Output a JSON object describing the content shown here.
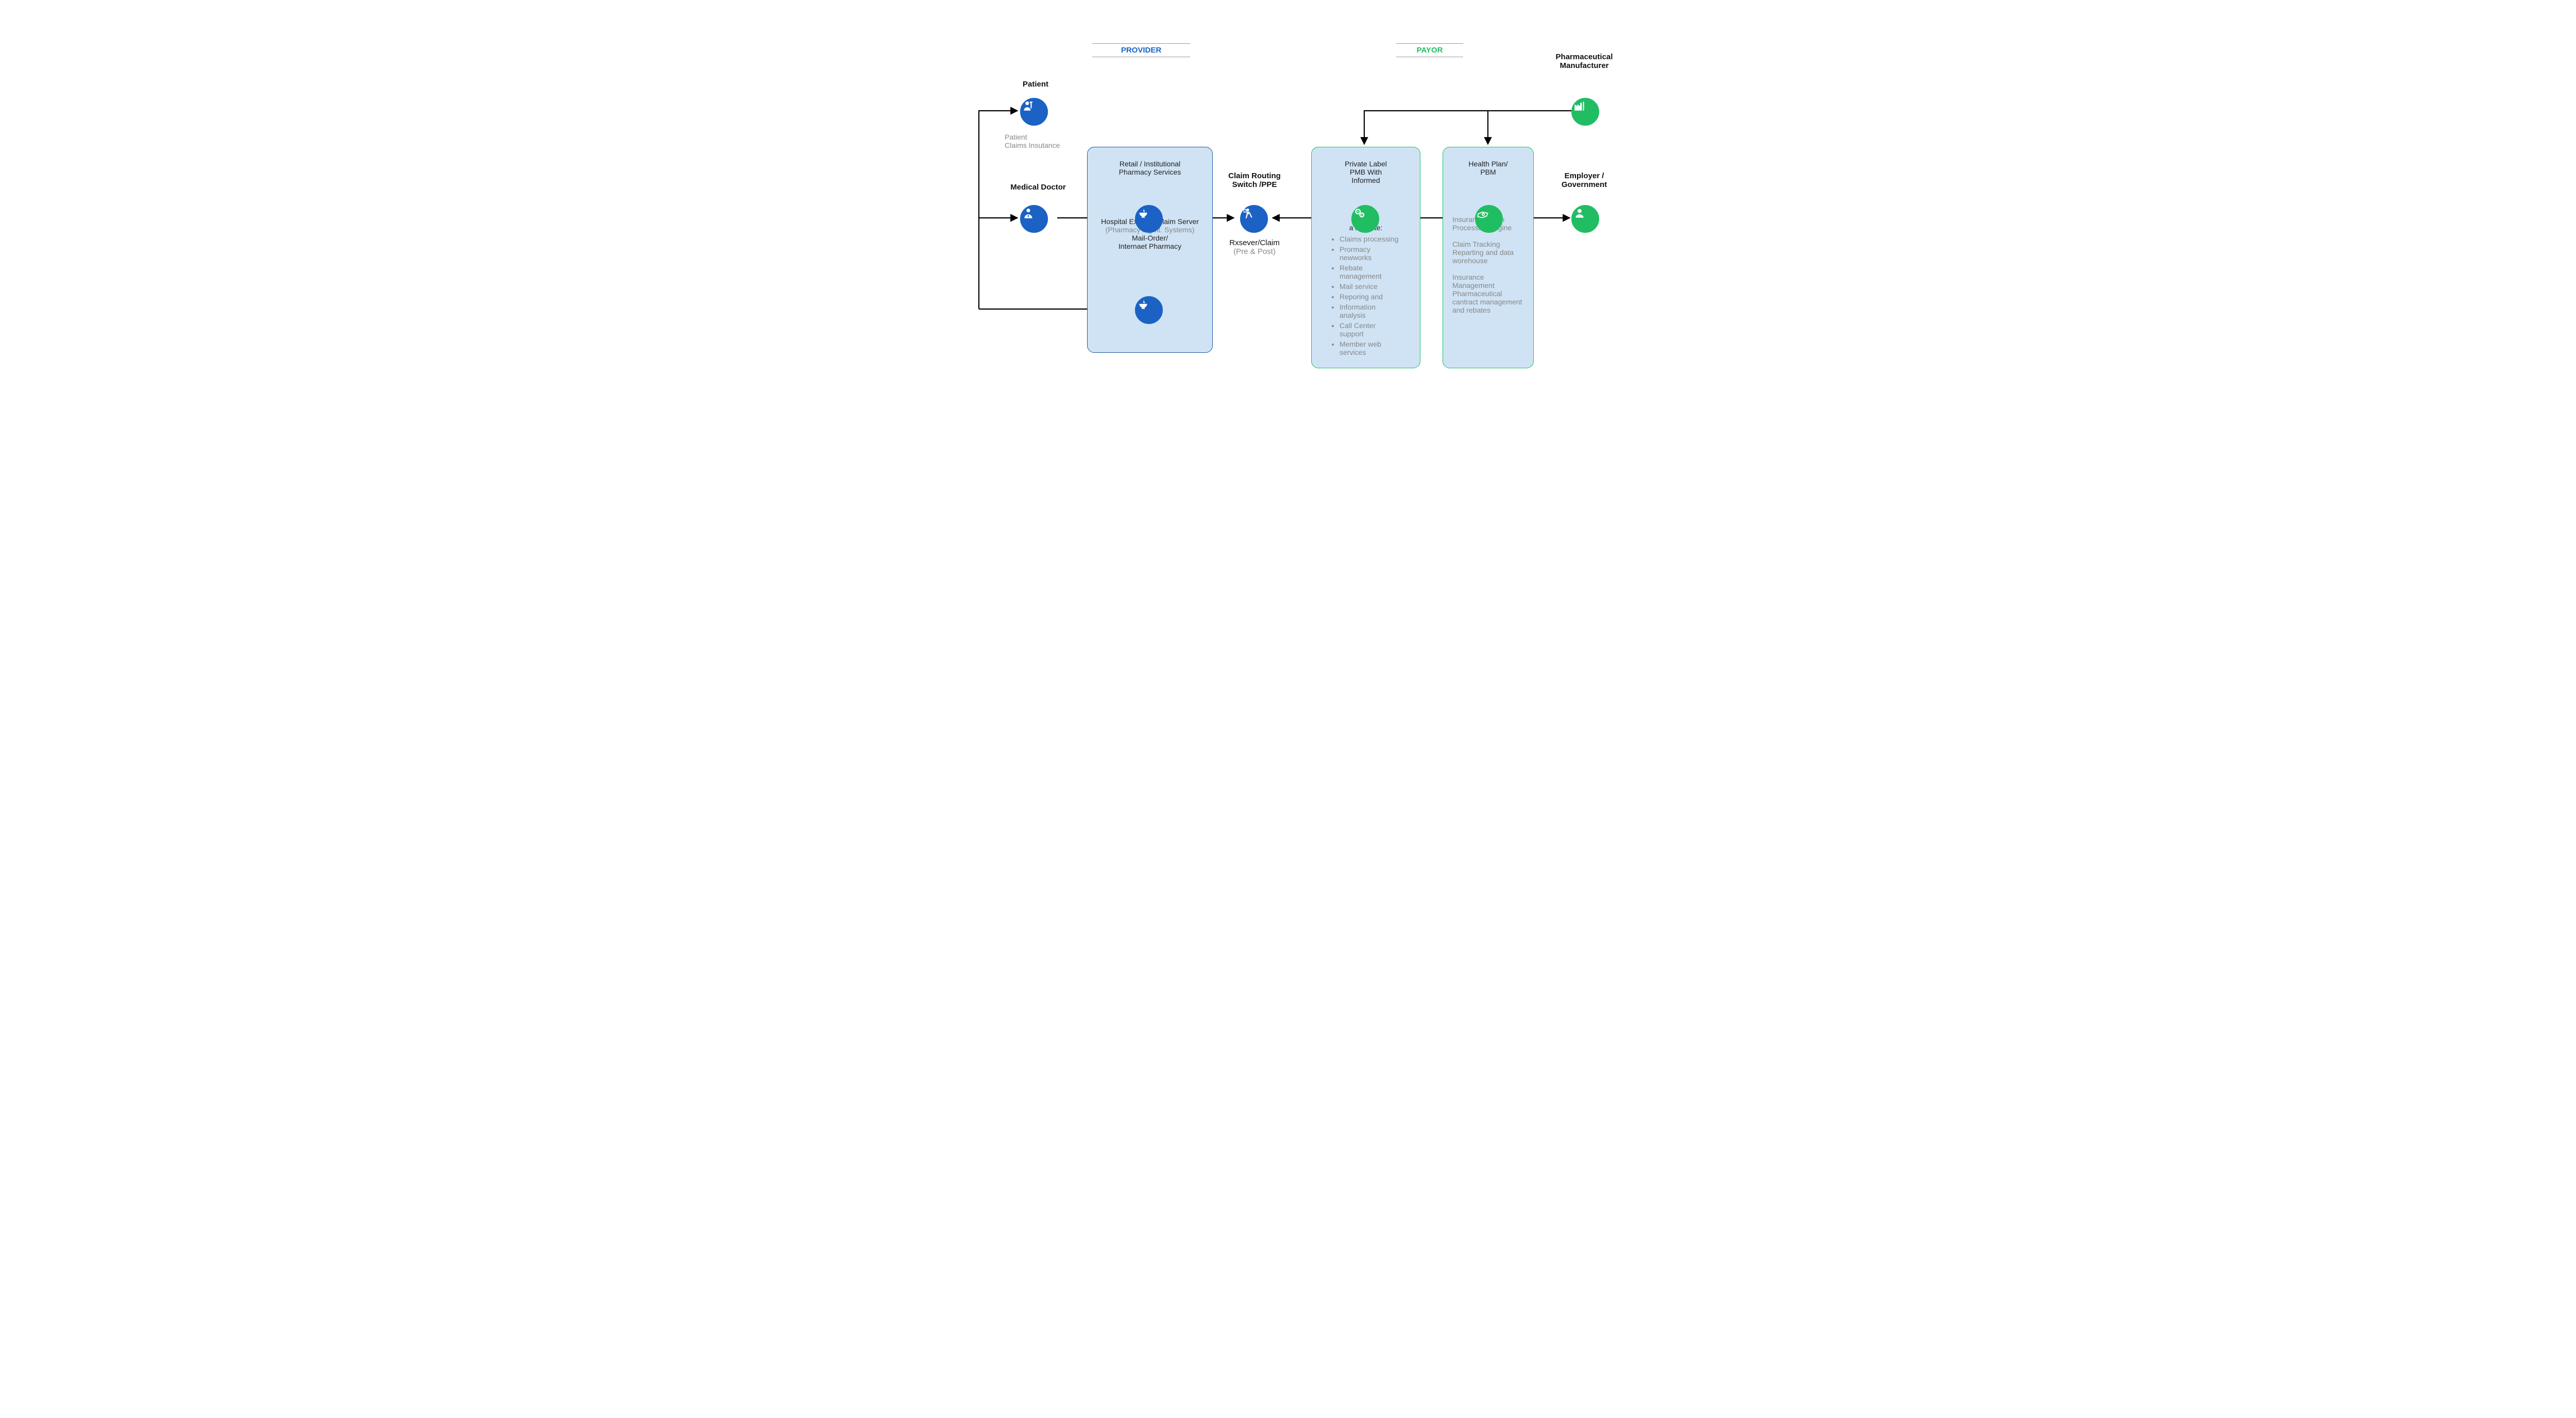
{
  "colors": {
    "blue": "#1b62c4",
    "green": "#21bd62",
    "box": "#cfe3f5",
    "grey": "#888"
  },
  "headers": {
    "provider": "PROVIDER",
    "payor": "PAYOR",
    "pharma": "Pharmaceutical Manufacturer"
  },
  "left": {
    "patient": "Patient",
    "patient_note1": "Patient",
    "patient_note2": "Claims Insutance",
    "medical_doctor": "Medical Doctor"
  },
  "provider_box": {
    "title1": "Retail / Institutional",
    "title2": "Pharmacy Services",
    "line1": "Hospital Express Claim Server",
    "line1_sub": "(Pharmacy Mgmt. Systems)",
    "line2": "Mail-Order/",
    "line3": "Internaet Pharmacy"
  },
  "router": {
    "title1": "Claim Routing",
    "title2": "Switch /PPE",
    "sub1": "Rxsever/Claim",
    "sub2": "(Pre & Post)"
  },
  "pmb_box": {
    "t1": "Private Label",
    "t2": "PMB With",
    "t3": "Informed",
    "alacarte": "a la Carte:",
    "items": [
      "Claims processing",
      "Prormacy newworks",
      "Rebate management",
      "Mail service",
      "Reporing and",
      "Information analysis",
      "Call Center support",
      "Member web services"
    ]
  },
  "plan_box": {
    "t1": "Health Plan/",
    "t2": "PBM",
    "p1": "Insurance Claim Processing engine",
    "p2": "Claim Tracking Reparting and data worehouse",
    "p3": "Insurance Management Pharmaceutical cantract management and rebates"
  },
  "right": {
    "emp1": "Employer /",
    "emp2": "Government"
  }
}
